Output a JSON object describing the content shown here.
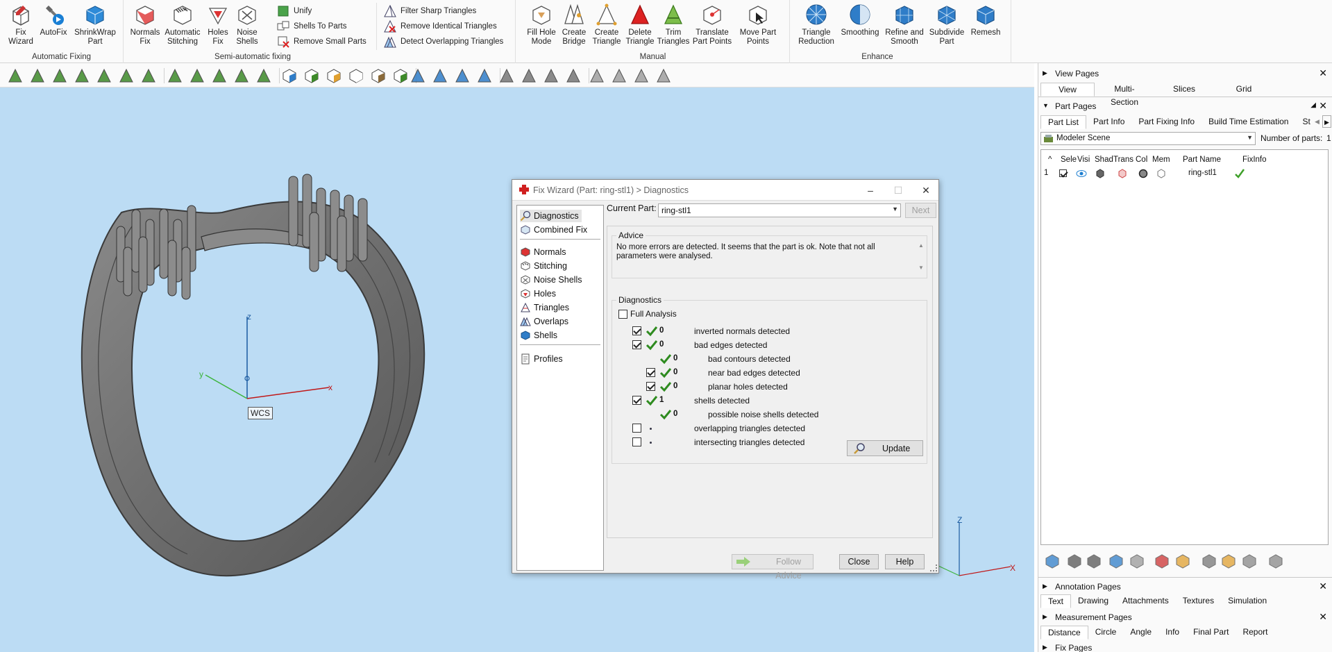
{
  "ribbon": {
    "automatic_fixing": {
      "label": "Automatic Fixing",
      "fix_wizard": "Fix\nWizard",
      "autofix": "AutoFix",
      "shrinkwrap": "ShrinkWrap\nPart"
    },
    "semi_automatic": {
      "label": "Semi-automatic fixing",
      "normals_fix": "Normals\nFix",
      "automatic_stitching": "Automatic\nStitching",
      "holes_fix": "Holes\nFix",
      "noise_shells": "Noise\nShells",
      "unify": "Unify",
      "shells_to_parts": "Shells To Parts",
      "remove_small_parts": "Remove Small Parts",
      "filter_sharp": "Filter Sharp Triangles",
      "remove_identical": "Remove Identical Triangles",
      "detect_overlapping": "Detect Overlapping Triangles"
    },
    "manual": {
      "label": "Manual",
      "fill_hole_mode": "Fill Hole\nMode",
      "create_bridge": "Create\nBridge",
      "create_triangle": "Create\nTriangle",
      "delete_triangle": "Delete\nTriangle",
      "trim_triangles": "Trim\nTriangles",
      "translate_part_points": "Translate\nPart Points",
      "move_part_points": "Move Part\nPoints"
    },
    "enhance": {
      "label": "Enhance",
      "triangle_reduction": "Triangle\nReduction",
      "smoothing": "Smoothing",
      "refine_smooth": "Refine and\nSmooth",
      "subdivide": "Subdivide\nPart",
      "remesh": "Remesh"
    }
  },
  "viewport": {
    "wcs_label": "WCS",
    "axis_x": "x",
    "axis_y": "y",
    "axis_z": "z",
    "mini_axis_x": "X",
    "mini_axis_z": "Z"
  },
  "dialog": {
    "title": "Fix Wizard (Part: ring-stl1) > Diagnostics",
    "nav_top": [
      "Diagnostics",
      "Combined Fix"
    ],
    "nav_mid": [
      "Normals",
      "Stitching",
      "Noise Shells",
      "Holes",
      "Triangles",
      "Overlaps",
      "Shells"
    ],
    "nav_bottom": [
      "Profiles"
    ],
    "current_part_label": "Current Part:",
    "current_part_value": "ring-stl1",
    "next_button": "Next",
    "advice_label": "Advice",
    "advice_text": "No more errors are detected. It seems that the part is ok. Note that not all parameters were analysed.",
    "diagnostics_label": "Diagnostics",
    "full_analysis_label": "Full Analysis",
    "rows": [
      {
        "count": "0",
        "label": "inverted normals detected",
        "checked": true,
        "ok": true,
        "indent": false
      },
      {
        "count": "0",
        "label": "bad edges detected",
        "checked": true,
        "ok": true,
        "indent": false
      },
      {
        "count": "0",
        "label": "bad contours detected",
        "checked": null,
        "ok": true,
        "indent": true
      },
      {
        "count": "0",
        "label": "near bad edges detected",
        "checked": true,
        "ok": true,
        "indent": true
      },
      {
        "count": "0",
        "label": "planar holes detected",
        "checked": true,
        "ok": true,
        "indent": true
      },
      {
        "count": "1",
        "label": "shells detected",
        "checked": true,
        "ok": true,
        "indent": false
      },
      {
        "count": "0",
        "label": "possible noise shells detected",
        "checked": null,
        "ok": true,
        "indent": true
      },
      {
        "count": "",
        "label": "overlapping triangles detected",
        "checked": false,
        "ok": false,
        "indent": false
      },
      {
        "count": "",
        "label": "intersecting triangles detected",
        "checked": false,
        "ok": false,
        "indent": false
      }
    ],
    "update_button": "Update",
    "follow_advice_button": "Follow Advice",
    "close_button": "Close",
    "help_button": "Help"
  },
  "rpanel": {
    "view_pages": "View Pages",
    "view_tabs": [
      "View",
      "Multi-Section",
      "Slices",
      "Grid"
    ],
    "part_pages": "Part Pages",
    "part_tabs": [
      "Part List",
      "Part Info",
      "Part Fixing Info",
      "Build Time Estimation",
      "St"
    ],
    "scene_select": "Modeler Scene",
    "num_parts_label": "Number of parts:",
    "num_parts_value": "1",
    "columns": [
      "^",
      "Sele",
      "Visi",
      "Shad",
      "Trans",
      "Col",
      "Mem",
      "Part Name",
      "FixInfo"
    ],
    "row_index": "1",
    "row_part_name": "ring-stl1",
    "annotation_pages": "Annotation Pages",
    "annotation_tabs": [
      "Text",
      "Drawing",
      "Attachments",
      "Textures",
      "Simulation"
    ],
    "measurement_pages": "Measurement Pages",
    "measurement_tabs": [
      "Distance",
      "Circle",
      "Angle",
      "Info",
      "Final Part",
      "Report"
    ],
    "fix_pages": "Fix Pages"
  }
}
